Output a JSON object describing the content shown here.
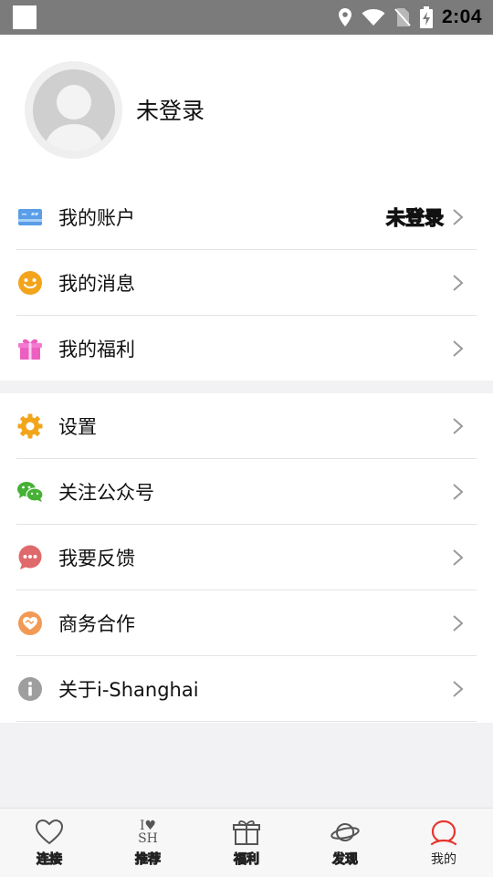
{
  "status_bar": {
    "time": "2:04"
  },
  "profile": {
    "name": "未登录"
  },
  "menu_group_1": [
    {
      "label": "我的账户",
      "value": "未登录",
      "icon": "card-icon"
    },
    {
      "label": "我的消息",
      "icon": "smiley-icon"
    },
    {
      "label": "我的福利",
      "icon": "gift-icon"
    }
  ],
  "menu_group_2": [
    {
      "label": "设置",
      "icon": "gear-icon"
    },
    {
      "label": "关注公众号",
      "icon": "wechat-icon"
    },
    {
      "label": "我要反馈",
      "icon": "chat-bubble-icon"
    },
    {
      "label": "商务合作",
      "icon": "handshake-icon"
    },
    {
      "label": "关于i-Shanghai",
      "icon": "info-icon"
    }
  ],
  "tabs": [
    {
      "label": "连接",
      "icon": "heart-outline-icon"
    },
    {
      "label": "推荐",
      "icon": "i-love-sh-icon",
      "logo_text": [
        "I",
        "SH"
      ]
    },
    {
      "label": "福利",
      "icon": "gift-outline-icon"
    },
    {
      "label": "发现",
      "icon": "planet-icon"
    },
    {
      "label": "我的",
      "icon": "person-icon",
      "active": true
    }
  ],
  "colors": {
    "accent_red": "#e8352f",
    "status_bar": "#7b7b7b",
    "divider": "#e3e3e3",
    "background": "#f2f1f4"
  }
}
